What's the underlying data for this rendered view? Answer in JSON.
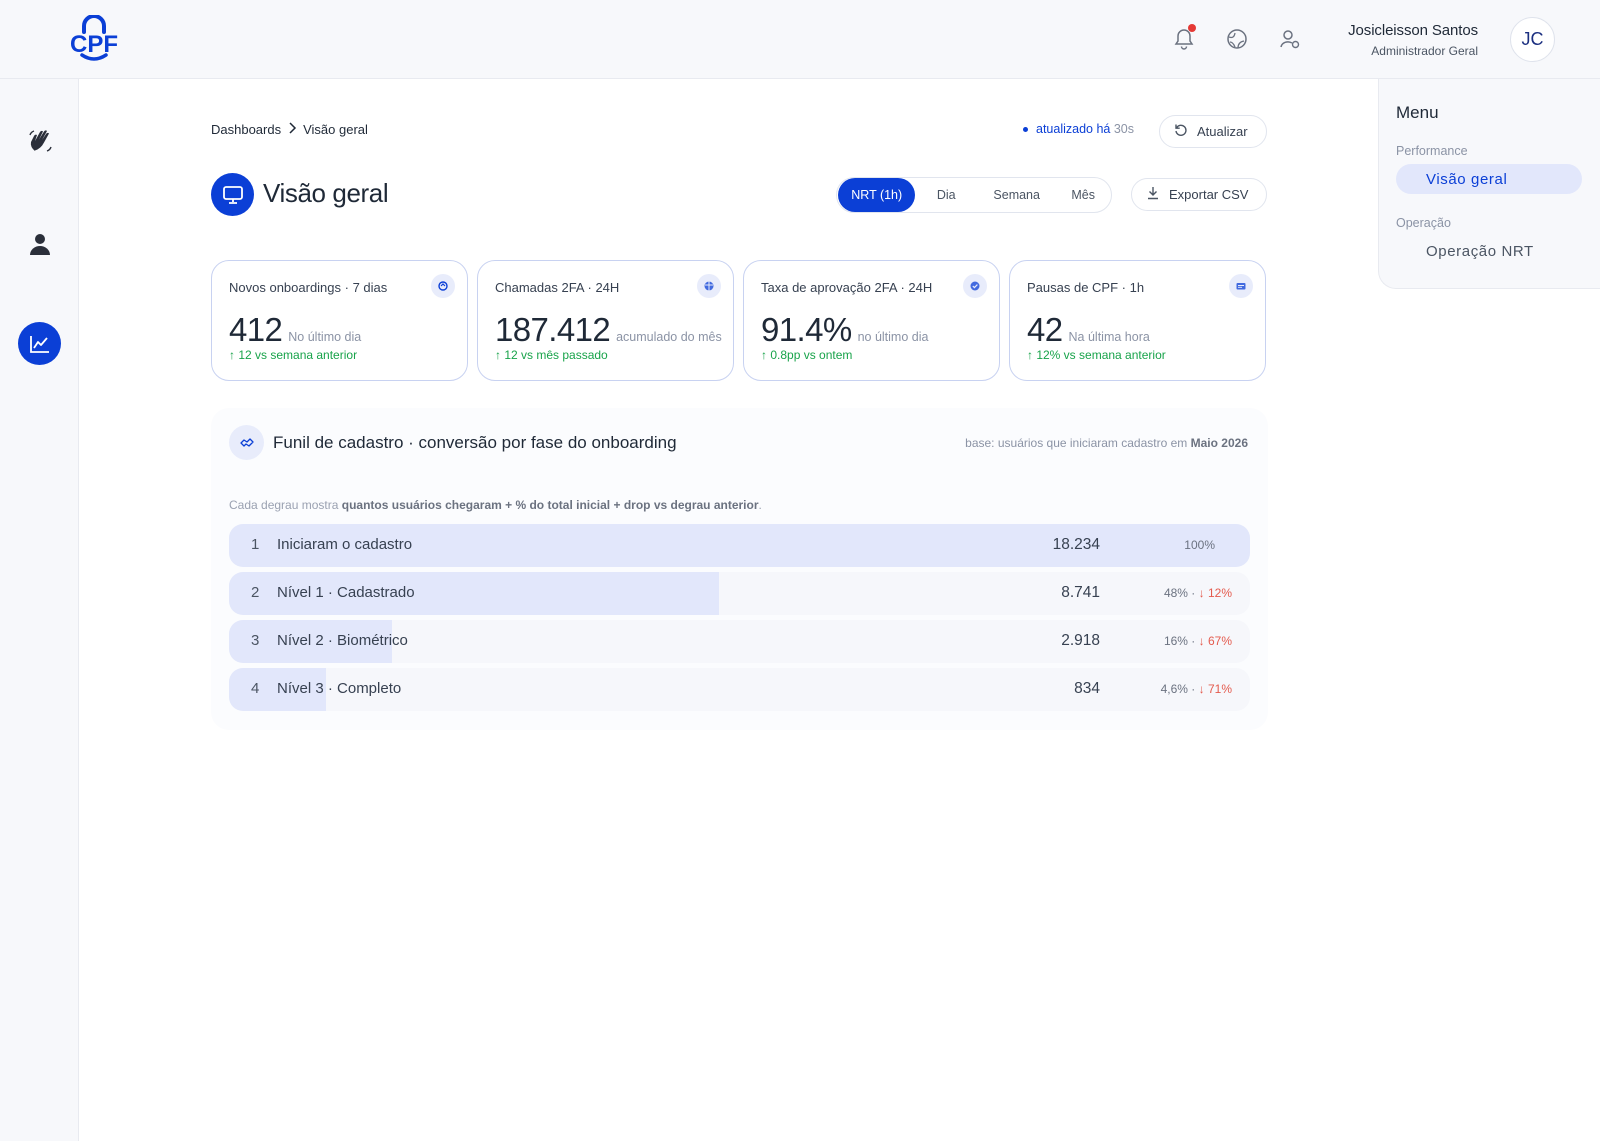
{
  "header": {
    "logo_text": "CPF",
    "user_name": "Josicleisson Santos",
    "user_role": "Administrador Geral",
    "avatar_initials": "JC"
  },
  "breadcrumb": {
    "root": "Dashboards",
    "current": "Visão geral"
  },
  "status": {
    "updated_label": "atualizado há",
    "updated_ago": "30s",
    "refresh_label": "Atualizar"
  },
  "page": {
    "title": "Visão geral"
  },
  "periods": {
    "items": [
      "NRT (1h)",
      "Dia",
      "Semana",
      "Mês"
    ],
    "selected": "NRT (1h)"
  },
  "export_label": "Exportar CSV",
  "kpis": [
    {
      "label": "Novos onboardings · 7  dias",
      "value": "412",
      "sub": "No último dia",
      "delta": "↑  12 vs semana anterior"
    },
    {
      "label": "Chamadas 2FA · 24H",
      "value": "187.412",
      "sub": "acumulado do mês",
      "delta": "↑  12 vs mês passado"
    },
    {
      "label": "Taxa de aprovação 2FA · 24H",
      "value": "91.4%",
      "sub": "no último dia",
      "delta": "↑  0.8pp vs ontem"
    },
    {
      "label": "Pausas de CPF · 1h",
      "value": "42",
      "sub": "Na última hora",
      "delta": "↑  12% vs semana anterior"
    }
  ],
  "funnel": {
    "title": "Funil de cadastro · conversão por fase do onboarding",
    "base_prefix": "base: usuários que iniciaram cadastro em",
    "base_month": "Maio 2026",
    "note_prefix": "Cada degrau mostra",
    "note_bold": "quantos usuários chegaram + % do total inicial + drop vs degrau anterior",
    "note_suffix": ".",
    "steps": [
      {
        "num": "1",
        "label": "Iniciaram o cadastro",
        "count": "18.234",
        "pct": "100%",
        "drop": "",
        "share": 1.0
      },
      {
        "num": "2",
        "label": "Nível 1 · Cadastrado",
        "count": "8.741",
        "pct": "48% ·",
        "drop": "↓ 12%",
        "share": 0.48
      },
      {
        "num": "3",
        "label": "Nível 2 · Biométrico",
        "count": "2.918",
        "pct": "16% ·",
        "drop": "↓ 67%",
        "share": 0.16
      },
      {
        "num": "4",
        "label": "Nível 3 · Completo",
        "count": "834",
        "pct": "4,6% ·",
        "drop": "↓ 71%",
        "share": 0.046
      }
    ]
  },
  "menu": {
    "title": "Menu",
    "sections": [
      {
        "label": "Performance",
        "items": [
          {
            "label": "Visão geral",
            "active": true
          }
        ]
      },
      {
        "label": "Operação",
        "items": [
          {
            "label": "Operação NRT",
            "active": false
          }
        ]
      }
    ]
  },
  "colors": {
    "brand": "#0b3fd6",
    "positive": "#18a34a",
    "negative": "#e45b4e",
    "notification": "#e53935"
  },
  "icons": {
    "top": [
      "bell-icon",
      "globe-icon",
      "user-settings-icon"
    ],
    "rail": [
      "wave-hand-icon",
      "person-icon",
      "chart-line-icon"
    ]
  }
}
